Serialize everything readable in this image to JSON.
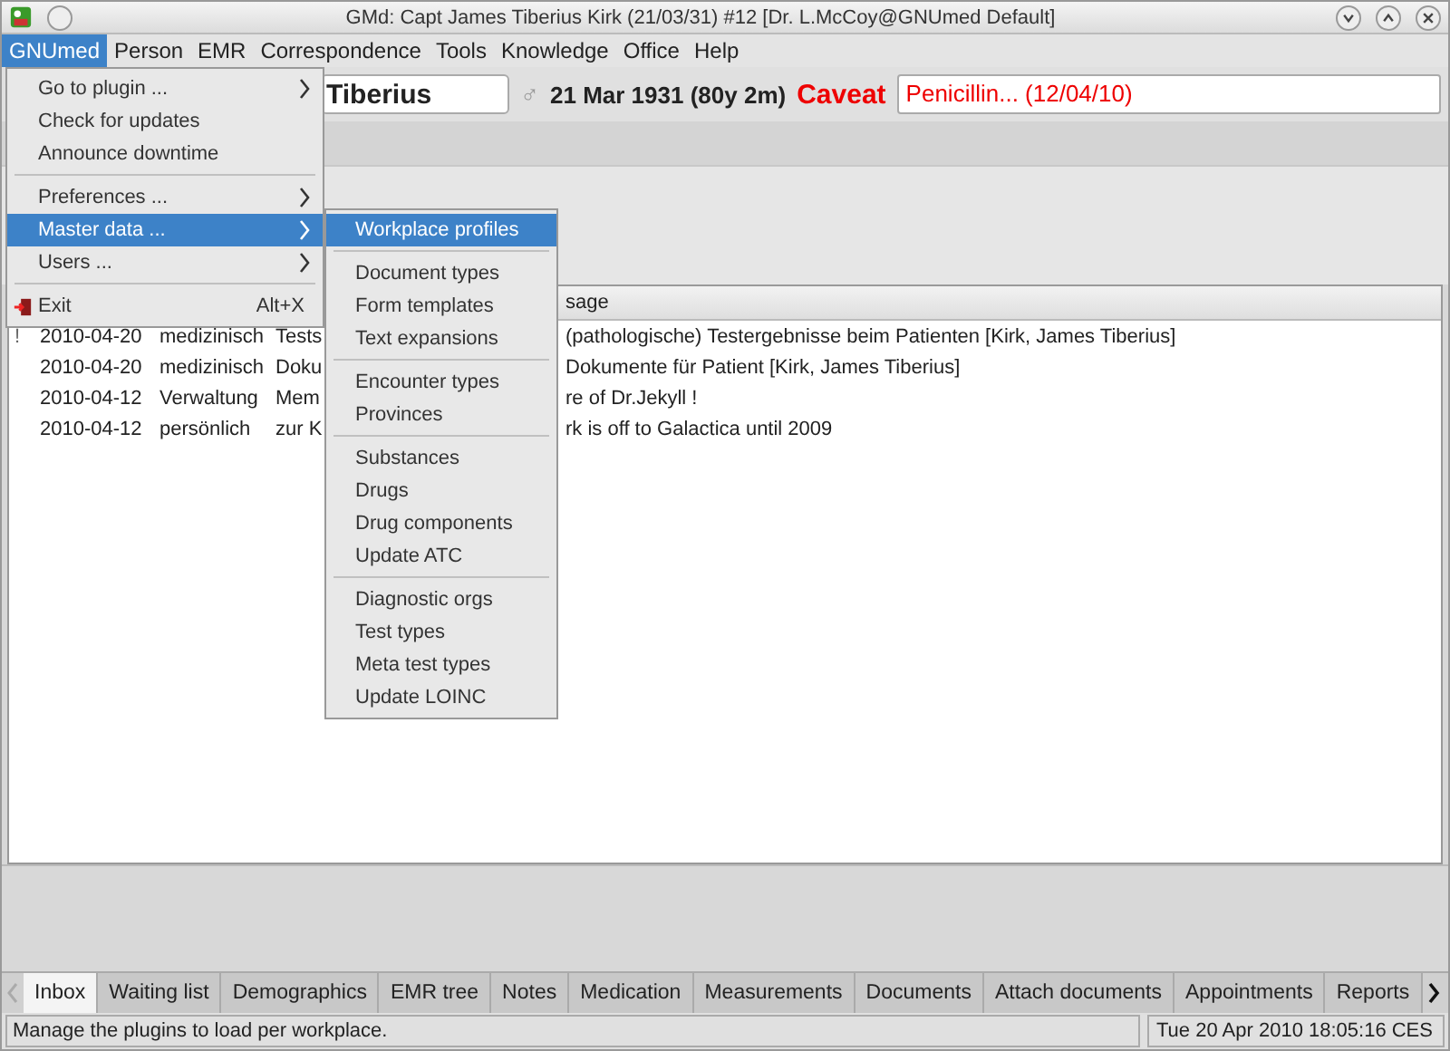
{
  "window": {
    "title": "GMd: Capt James Tiberius Kirk (21/03/31) #12 [Dr. L.McCoy@GNUmed Default]"
  },
  "menubar": [
    {
      "label": "GNUmed",
      "selected": true
    },
    {
      "label": "Person",
      "selected": false
    },
    {
      "label": "EMR",
      "selected": false
    },
    {
      "label": "Correspondence",
      "selected": false
    },
    {
      "label": "Tools",
      "selected": false
    },
    {
      "label": "Knowledge",
      "selected": false
    },
    {
      "label": "Office",
      "selected": false
    },
    {
      "label": "Help",
      "selected": false
    }
  ],
  "patient": {
    "name": "Tiberius",
    "gender": "♂",
    "dob": "21 Mar 1931 (80y 2m)",
    "caveat_label": "Caveat",
    "caveat": "Penicillin... (12/04/10)"
  },
  "inbox": {
    "columns": [
      "sage"
    ],
    "rows": [
      {
        "flag": "!",
        "date": "2010-04-20",
        "category": "medizinisch",
        "column_4": "Tests",
        "message": "(pathologische) Testergebnisse beim Patienten [Kirk, James Tiberius]"
      },
      {
        "flag": "",
        "date": "2010-04-20",
        "category": "medizinisch",
        "column_4": "Doku",
        "message": "Dokumente für Patient [Kirk, James Tiberius]"
      },
      {
        "flag": "",
        "date": "2010-04-12",
        "category": "Verwaltung",
        "column_4": "Mem",
        "message": "re of Dr.Jekyll !"
      },
      {
        "flag": "",
        "date": "2010-04-12",
        "category": "persönlich",
        "column_4": "zur K",
        "message": "rk is off to Galactica until 2009"
      }
    ]
  },
  "menu": {
    "items": [
      {
        "kind": "item",
        "label": "Go to plugin ...",
        "submenu": true,
        "selected": false
      },
      {
        "kind": "item",
        "label": "Check for updates",
        "submenu": false,
        "selected": false
      },
      {
        "kind": "item",
        "label": "Announce downtime",
        "submenu": false,
        "selected": false
      },
      {
        "kind": "separator"
      },
      {
        "kind": "item",
        "label": "Preferences ...",
        "submenu": true,
        "selected": false
      },
      {
        "kind": "item",
        "label": "Master data ...",
        "submenu": true,
        "selected": true
      },
      {
        "kind": "item",
        "label": "Users ...",
        "submenu": true,
        "selected": false
      },
      {
        "kind": "separator"
      },
      {
        "kind": "item",
        "label": "Exit",
        "shortcut": "Alt+X",
        "icon": true,
        "submenu": false,
        "selected": false
      }
    ]
  },
  "submenu": {
    "items": [
      {
        "kind": "item",
        "label": "Workplace profiles",
        "selected": true
      },
      {
        "kind": "separator"
      },
      {
        "kind": "item",
        "label": "Document types",
        "selected": false
      },
      {
        "kind": "item",
        "label": "Form templates",
        "selected": false
      },
      {
        "kind": "item",
        "label": "Text expansions",
        "selected": false
      },
      {
        "kind": "separator"
      },
      {
        "kind": "item",
        "label": "Encounter types",
        "selected": false
      },
      {
        "kind": "item",
        "label": "Provinces",
        "selected": false
      },
      {
        "kind": "separator"
      },
      {
        "kind": "item",
        "label": "Substances",
        "selected": false
      },
      {
        "kind": "item",
        "label": "Drugs",
        "selected": false
      },
      {
        "kind": "item",
        "label": "Drug components",
        "selected": false
      },
      {
        "kind": "item",
        "label": "Update ATC",
        "selected": false
      },
      {
        "kind": "separator"
      },
      {
        "kind": "item",
        "label": "Diagnostic orgs",
        "selected": false
      },
      {
        "kind": "item",
        "label": "Test types",
        "selected": false
      },
      {
        "kind": "item",
        "label": "Meta test types",
        "selected": false
      },
      {
        "kind": "item",
        "label": "Update LOINC",
        "selected": false
      }
    ]
  },
  "tabs": [
    {
      "label": "Inbox",
      "selected": true
    },
    {
      "label": "Waiting list",
      "selected": false
    },
    {
      "label": "Demographics",
      "selected": false
    },
    {
      "label": "EMR tree",
      "selected": false
    },
    {
      "label": "Notes",
      "selected": false
    },
    {
      "label": "Medication",
      "selected": false
    },
    {
      "label": "Measurements",
      "selected": false
    },
    {
      "label": "Documents",
      "selected": false
    },
    {
      "label": "Attach documents",
      "selected": false
    },
    {
      "label": "Appointments",
      "selected": false
    },
    {
      "label": "Reports",
      "selected": false
    }
  ],
  "status_bar": {
    "message": "Manage the plugins to load per workplace.",
    "clock": "Tue 20 Apr 2010 18:05:16 CES"
  }
}
